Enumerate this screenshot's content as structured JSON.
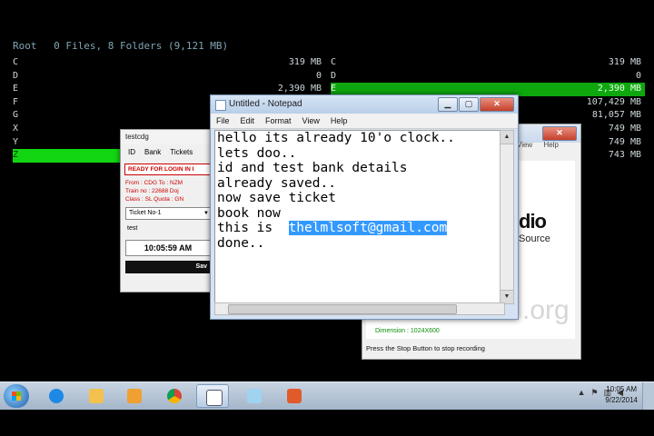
{
  "file_manager": {
    "root_label": "Root",
    "summary": "0 Files, 8 Folders (9,121 MB)",
    "left_drives": [
      {
        "letter": "C",
        "size": "319 MB"
      },
      {
        "letter": "D",
        "size": "0"
      },
      {
        "letter": "E",
        "size": "2,390 MB"
      },
      {
        "letter": "F",
        "size": ""
      },
      {
        "letter": "G",
        "size": ""
      },
      {
        "letter": "X",
        "size": ""
      },
      {
        "letter": "Y",
        "size": ""
      },
      {
        "letter": "Z",
        "size": ""
      }
    ],
    "right_drives": [
      {
        "letter": "C",
        "size": "319 MB"
      },
      {
        "letter": "D",
        "size": "0"
      },
      {
        "letter": "E",
        "size": "2,390 MB"
      },
      {
        "letter": "F",
        "size": "107,429 MB"
      },
      {
        "letter": "G",
        "size": "81,057 MB"
      },
      {
        "letter": "X",
        "size": "749 MB"
      },
      {
        "letter": "Y",
        "size": "749 MB"
      },
      {
        "letter": "Z",
        "size": "743 MB"
      }
    ]
  },
  "notepad": {
    "title": "Untitled - Notepad",
    "menu": [
      "File",
      "Edit",
      "Format",
      "View",
      "Help"
    ],
    "lines": [
      "hello its already 10'o clock..",
      "lets doo..",
      "id and test bank details",
      "already saved..",
      "now save ticket",
      "book now"
    ],
    "line7_prefix": "this is  ",
    "line7_selected": "thelmlsoft@gmail.com",
    "line8": "done.."
  },
  "testcdg": {
    "title": "testcdg",
    "tabs": [
      "ID",
      "Bank",
      "Tickets"
    ],
    "alert": "READY FOR LOGIN IN I",
    "info_lines": [
      "From : CDG  To : NZM",
      "Train no : 22688  Doj",
      "Class : SL  Quota : GN"
    ],
    "ticket_select": "Ticket No-1",
    "input_value": "test",
    "time": "10:05:59 AM",
    "save_label": "Sav"
  },
  "recorder": {
    "menu": [
      "View",
      "Help"
    ],
    "logo_text": "dio",
    "logo_sub": "Source",
    "watermark": ".org",
    "dimension": "Dimension : 1024X600",
    "status": "Press the Stop Button to stop recording"
  },
  "taskbar": {
    "time": "10:05 AM",
    "date": "9/22/2014"
  }
}
